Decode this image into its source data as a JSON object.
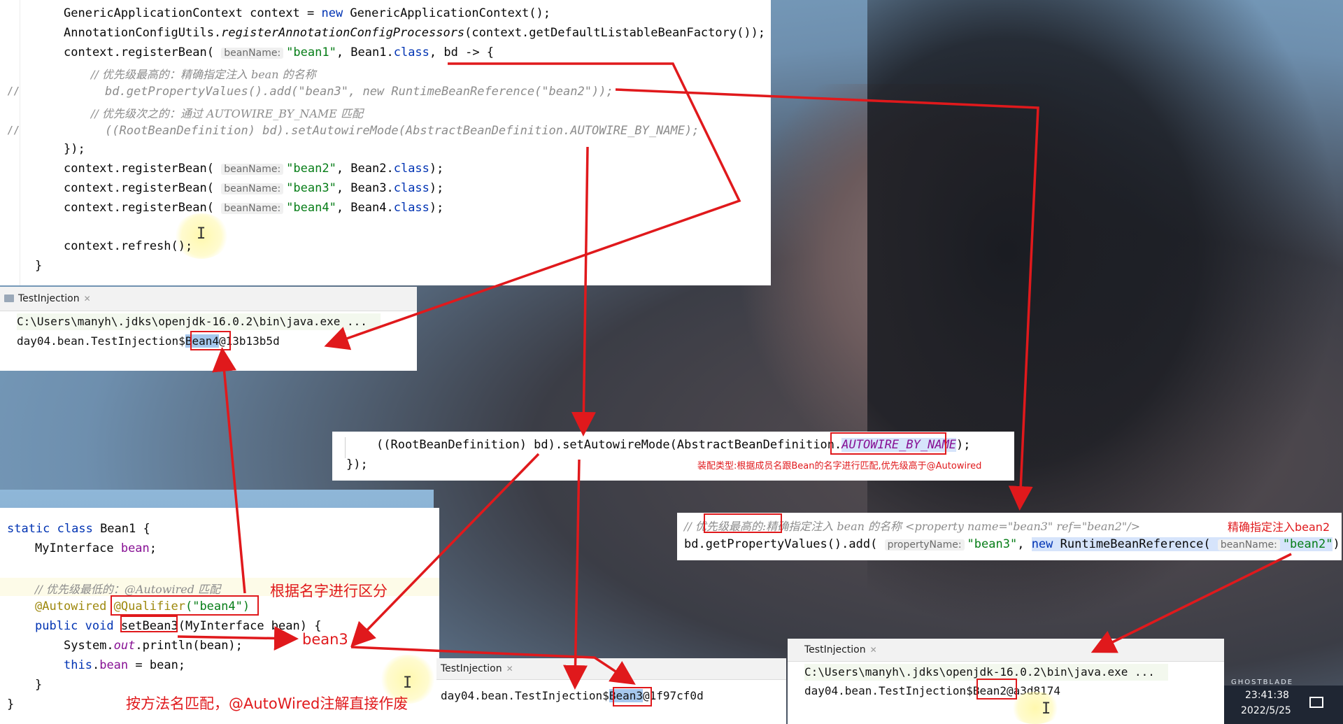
{
  "colors": {
    "keyword": "#0033b3",
    "string": "#067d17",
    "comment": "#8c8c8c",
    "annotation": "#9e880d",
    "field": "#871094",
    "red": "#e0191c",
    "highlight": "#a6c8ee"
  },
  "editor_top": {
    "line1_a": "GenericApplicationContext context = ",
    "line1_kw": "new",
    "line1_b": " GenericApplicationContext();",
    "line2_a": "AnnotationConfigUtils.",
    "line2_m": "registerAnnotationConfigProcessors",
    "line2_b": "(context.getDefaultListableBeanFactory());",
    "line3_a": "context.registerBean(",
    "hint_beanName": "beanName:",
    "line3_str": "\"bean1\"",
    "line3_b": ", Bean1.",
    "kw_class": "class",
    "line3_c": ", bd -> {",
    "cmt1": "// 优先级最高的：精确指定注入 bean 的名称",
    "gutter_comment": "//",
    "line5": "bd.getPropertyValues().add(\"bean3\", new RuntimeBeanReference(\"bean2\"));",
    "cmt2": "// 优先级次之的：通过 AUTOWIRE_BY_NAME 匹配",
    "line7": "((RootBeanDefinition) bd).setAutowireMode(AbstractBeanDefinition.AUTOWIRE_BY_NAME);",
    "line8": "});",
    "reg_a": "context.registerBean(",
    "str_bean2": "\"bean2\"",
    "reg_b2": ", Bean2.",
    "str_bean3": "\"bean3\"",
    "reg_b3": ", Bean3.",
    "str_bean4": "\"bean4\"",
    "reg_b4": ", Bean4.",
    "reg_end": ");",
    "refresh": "context.refresh();",
    "close_brace": "}"
  },
  "console1": {
    "tab": "TestInjection",
    "cmd": "C:\\Users\\manyh\\.jdks\\openjdk-16.0.2\\bin\\java.exe ...",
    "out_a": "day04.bean.TestInjection$",
    "out_hl": "Bean4",
    "out_b": "@13b13b5d"
  },
  "mid_snippet": {
    "line1_a": "((RootBeanDefinition) bd).setAutowireMode(AbstractBeanDefinition.",
    "line1_hl": "AUTOWIRE_BY_NAME",
    "line1_b": ");",
    "line2": "});",
    "note": "装配类型:根据成员名跟Bean的名字进行匹配,优先级高于@Autowired"
  },
  "right_snippet": {
    "cmt_a": "// ",
    "cmt_box": "优先级最高的:",
    "cmt_b": "精确指定注入 bean 的名称 <property name=\"bean3\" ref=\"bean2\"/>",
    "note": "精确指定注入bean2",
    "line_a": "bd.getPropertyValues().add(",
    "hint_propertyName": "propertyName:",
    "str_bean3": "\"bean3\"",
    "comma": ", ",
    "kw_new": "new",
    "rbr": " RuntimeBeanReference(",
    "hint_beanName": "beanName:",
    "str_bean2": "\"bean2\"",
    "line_end": "));"
  },
  "bean1_class": {
    "l1_kw": "static class",
    "l1_b": " Bean1 {",
    "l2_a": "MyInterface ",
    "l2_f": "bean",
    "l2_b": ";",
    "cmt": "// 优先级最低的：@Autowired 匹配",
    "ann1": "@Autowired",
    "ann2": "@Qualifier",
    "ann2_arg": "(\"bean4\")",
    "l5_kw": "public void",
    "l5_a": " set",
    "l5_b": "Bean3",
    "l5_c": "(MyInterface bean) {",
    "l6_a": "System.",
    "l6_f": "out",
    "l6_b": ".println(bean);",
    "l7_kw": "this",
    "l7_a": ".",
    "l7_f": "bean",
    "l7_b": " = bean;",
    "l8": "}",
    "l9": "}"
  },
  "annotations": {
    "by_name": "根据名字进行区分",
    "bean3": "bean3",
    "method_match": "按方法名匹配，@AutoWired注解直接作废"
  },
  "console2": {
    "tab": "TestInjection",
    "out_a": "day04.bean.TestInjection$",
    "out_hl": "Bean3",
    "out_b": "@1f97cf0d"
  },
  "console3": {
    "tab": "TestInjection",
    "cmd": "C:\\Users\\manyh\\.jdks\\openjdk-16.0.2\\bin\\java.exe ...",
    "out_a": "day04.bean.TestInjection$",
    "out_hl": "Bean2",
    "out_b": "@a3d8174"
  },
  "taskbar": {
    "time": "23:41:38",
    "date": "2022/5/25"
  }
}
